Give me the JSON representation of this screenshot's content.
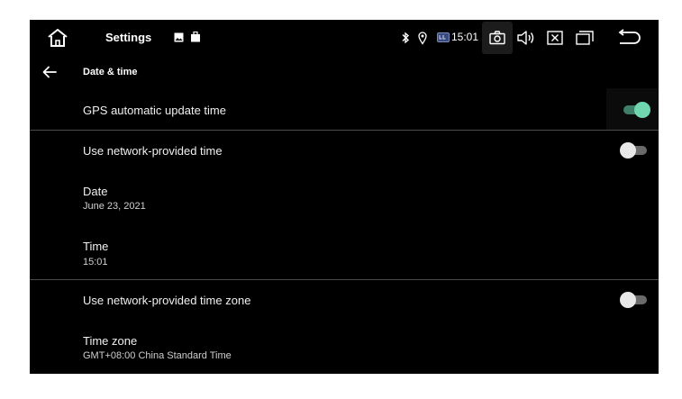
{
  "statusbar": {
    "app_title": "Settings",
    "clock": "15:01",
    "icons": [
      "home-icon",
      "image-notification-icon",
      "bag-notification-icon",
      "bluetooth-icon",
      "location-pin-icon",
      "usb-icon",
      "camera-icon",
      "volume-icon",
      "mute-box-icon",
      "window-icon",
      "back-icon"
    ]
  },
  "header": {
    "title": "Date & time"
  },
  "settings": [
    {
      "title": "GPS automatic update time",
      "toggle": true
    },
    {
      "title": "Use network-provided time",
      "toggle": false
    },
    {
      "title": "Date",
      "value": "June 23, 2021"
    },
    {
      "title": "Time",
      "value": "15:01"
    },
    {
      "title": "Use network-provided time zone",
      "toggle": false
    },
    {
      "title": "Time zone",
      "value": "GMT+08:00 China Standard Time"
    }
  ],
  "colors": {
    "accent": "#6fd6b0",
    "background": "#000000",
    "divider": "#4a4a4a"
  }
}
